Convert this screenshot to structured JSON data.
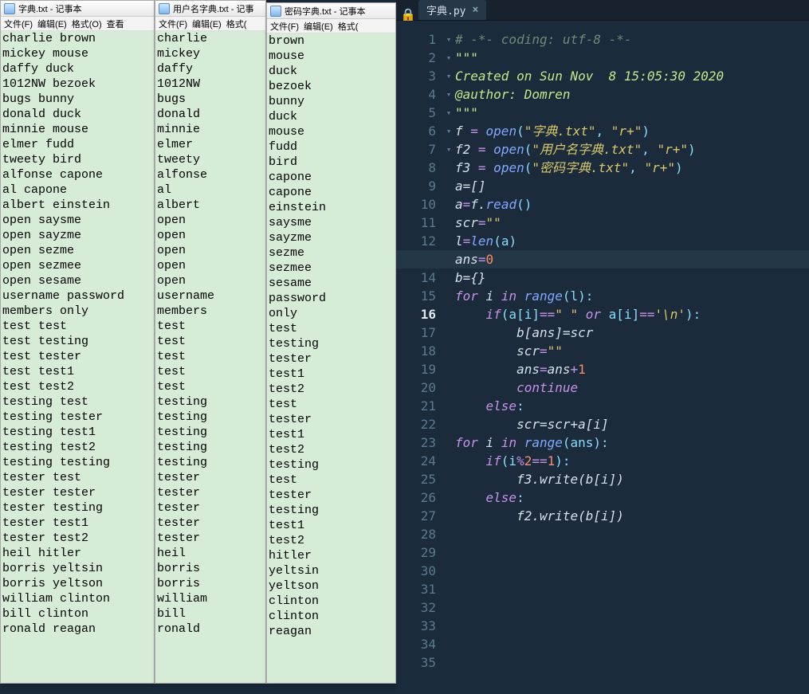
{
  "notepad1": {
    "title": "字典.txt - 记事本",
    "menus": [
      "文件(F)",
      "编辑(E)",
      "格式(O)",
      "查看"
    ],
    "lines": [
      "charlie brown",
      "mickey mouse",
      "daffy duck",
      "1012NW bezoek",
      "bugs bunny",
      "donald duck",
      "minnie mouse",
      "elmer fudd",
      "tweety bird",
      "alfonse capone",
      "al capone",
      "albert einstein",
      "open saysme",
      "open sayzme",
      "open sezme",
      "open sezmee",
      "open sesame",
      "username password",
      "members only",
      "test test",
      "test testing",
      "test tester",
      "test test1",
      "test test2",
      "testing test",
      "testing tester",
      "testing test1",
      "testing test2",
      "testing testing",
      "tester test",
      "tester tester",
      "tester testing",
      "tester test1",
      "tester test2",
      "heil hitler",
      "borris yeltsin",
      "borris yeltson",
      "william clinton",
      "bill clinton",
      "ronald reagan"
    ]
  },
  "notepad2": {
    "title": "用户名字典.txt - 记事",
    "menus": [
      "文件(F)",
      "编辑(E)",
      "格式("
    ],
    "lines": [
      "charlie",
      "mickey",
      "daffy",
      "1012NW",
      "bugs",
      "donald",
      "minnie",
      "elmer",
      "tweety",
      "alfonse",
      "al",
      "albert",
      "open",
      "open",
      "open",
      "open",
      "open",
      "username",
      "members",
      "test",
      "test",
      "test",
      "test",
      "test",
      "testing",
      "testing",
      "testing",
      "testing",
      "testing",
      "tester",
      "tester",
      "tester",
      "tester",
      "tester",
      "heil",
      "borris",
      "borris",
      "william",
      "bill",
      "ronald"
    ]
  },
  "notepad3": {
    "title": "密码字典.txt - 记事本",
    "menus": [
      "文件(F)",
      "编辑(E)",
      "格式("
    ],
    "lines": [
      "brown",
      "mouse",
      "duck",
      "bezoek",
      "bunny",
      "duck",
      "mouse",
      "fudd",
      "bird",
      "capone",
      "capone",
      "einstein",
      "saysme",
      "sayzme",
      "sezme",
      "sezmee",
      "sesame",
      "password",
      "only",
      "test",
      "testing",
      "tester",
      "test1",
      "test2",
      "test",
      "tester",
      "test1",
      "test2",
      "testing",
      "test",
      "tester",
      "testing",
      "test1",
      "test2",
      "hitler",
      "yeltsin",
      "yeltson",
      "clinton",
      "clinton",
      "reagan"
    ]
  },
  "editor": {
    "tab": "字典.py",
    "lock_glyph": "🔒",
    "close_glyph": "×",
    "current_line": 16,
    "code": {
      "l1": "# -*- coding: utf-8 -*-",
      "l2": "\"\"\"",
      "l3": "Created on Sun Nov  8 15:05:30 2020",
      "l4": "",
      "l5": "@author: Domren",
      "l6": "\"\"\"",
      "l7": "",
      "l8": "",
      "l9_pre": "f ",
      "l9_eq": "=",
      "l9_fn": " open",
      "l9_p1": "(",
      "l9_s1": "\"字典.txt\"",
      "l9_c": ", ",
      "l9_s2": "\"r+\"",
      "l9_p2": ")",
      "l10_pre": "f2 ",
      "l10_eq": "=",
      "l10_fn": " open",
      "l10_p1": "(",
      "l10_s1": "\"用户名字典.txt\"",
      "l10_c": ", ",
      "l10_s2": "\"r+\"",
      "l10_p2": ")",
      "l11_pre": "f3 ",
      "l11_eq": "=",
      "l11_fn": " open",
      "l11_p1": "(",
      "l11_s1": "\"密码字典.txt\"",
      "l11_c": ", ",
      "l11_s2": "\"r+\"",
      "l11_p2": ")",
      "l12": "a=[]",
      "l13_a": "a",
      "l13_eq": "=",
      "l13_f": "f.",
      "l13_fn": "read",
      "l13_p": "()",
      "l14_a": "scr",
      "l14_eq": "=",
      "l14_s": "\"\"",
      "l15_a": "l",
      "l15_eq": "=",
      "l15_fn": "len",
      "l15_p": "(a)",
      "l16_a": "ans",
      "l16_eq": "=",
      "l16_n": "0",
      "l17": "b={}",
      "l18": "",
      "l19_for": "for",
      "l19_mid": " i ",
      "l19_in": "in",
      "l19_sp": " ",
      "l19_fn": "range",
      "l19_p": "(l):",
      "l20_if": "if",
      "l20_body": "(a[i]",
      "l20_eq": "==",
      "l20_s1": "\" \"",
      "l20_or": " or ",
      "l20_body2": "a[i]",
      "l20_eq2": "==",
      "l20_s2": "'\\n'",
      "l20_end": "):",
      "l21": "b[ans]=scr",
      "l22_a": "scr",
      "l22_eq": "=",
      "l22_s": "\"\"",
      "l23_a": "ans",
      "l23_eq": "=",
      "l23_b": "ans",
      "l23_op": "+",
      "l23_n": "1",
      "l24": "continue",
      "l25_e": "else",
      "l25_c": ":",
      "l26": "scr=scr+a[i]",
      "l27": "",
      "l28_for": "for",
      "l28_mid": " i ",
      "l28_in": "in",
      "l28_sp": " ",
      "l28_fn": "range",
      "l28_p": "(ans):",
      "l29_if": "if",
      "l29_body": "(i",
      "l29_op": "%",
      "l29_n": "2",
      "l29_eq": "==",
      "l29_n2": "1",
      "l29_end": "):",
      "l30": "f3.write(b[i])",
      "l31_e": "else",
      "l31_c": ":",
      "l32": "f2.write(b[i])"
    }
  }
}
